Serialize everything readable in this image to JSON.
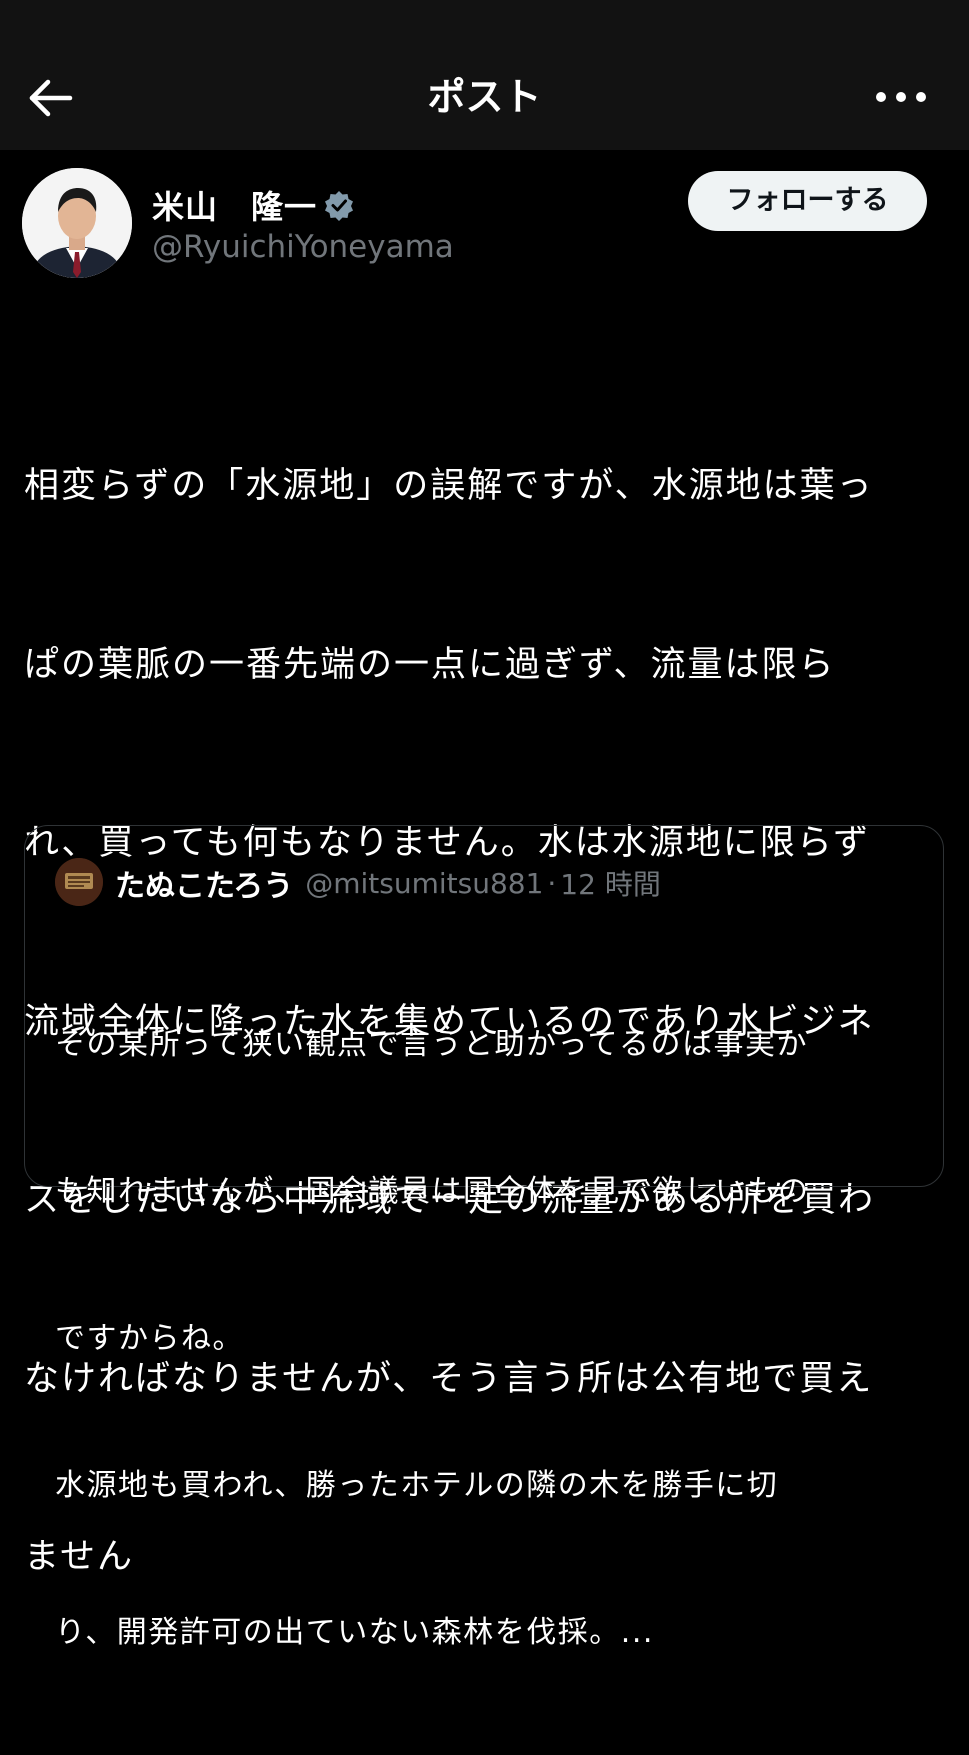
{
  "header": {
    "title": "ポスト",
    "back_icon": "arrow-left-icon",
    "more_icon": "more-horizontal-icon"
  },
  "author": {
    "name": "米山　隆一",
    "handle": "@RyuichiYoneyama",
    "verified": true,
    "follow_label": "フォローする"
  },
  "post": {
    "lines": [
      "相変らずの「水源地」の誤解ですが、水源地は葉っ",
      "ぱの葉脈の一番先端の一点に過ぎず、流量は限ら",
      "れ、買っても何もなりません。水は水源地に限らず",
      "流域全体に降った水を集めているのであり水ビジネ",
      "スをしたいなら中流域で一定の流量がある所を買わ",
      "なければなりませんが、そう言う所は公有地で買え",
      "ません"
    ]
  },
  "quote": {
    "name": "たぬこたろう",
    "handle": "@mitsumitsu881",
    "separator": "·",
    "time": "12 時間",
    "lines": [
      "その某所って狭い観点で言うと助かってるのは事実か",
      "も知れませんが、国会議員は国全体を見て欲しいもの",
      "ですからね。",
      "水源地も買われ、勝ったホテルの隣の木を勝手に切",
      "り、開発許可の出ていない森林を伐採。..."
    ]
  },
  "colors": {
    "background": "#000000",
    "header_background": "#121212",
    "text_primary": "#ffffff",
    "text_secondary": "#71767b",
    "verified": "#829aab",
    "follow_button_bg": "#eff3f4",
    "border": "#2f3336"
  }
}
